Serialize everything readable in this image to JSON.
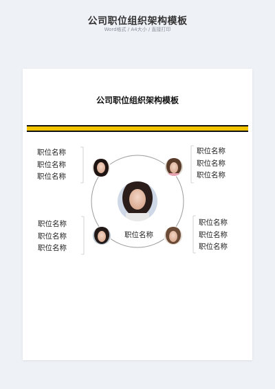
{
  "header": {
    "title": "公司职位组织架构模板",
    "subtitle": "Word格式 / A4大小 / 直接打印"
  },
  "document": {
    "title": "公司职位组织架构模板",
    "accent_color": "#f2c300",
    "groups": {
      "top_left": [
        "职位名称",
        "职位名称",
        "职位名称"
      ],
      "top_right": [
        "职位名称",
        "职位名称",
        "职位名称"
      ],
      "bottom_left": [
        "职位名称",
        "职位名称",
        "职位名称"
      ],
      "bottom_right": [
        "职位名称",
        "职位名称",
        "职位名称"
      ]
    },
    "center_label": "职位名称"
  }
}
